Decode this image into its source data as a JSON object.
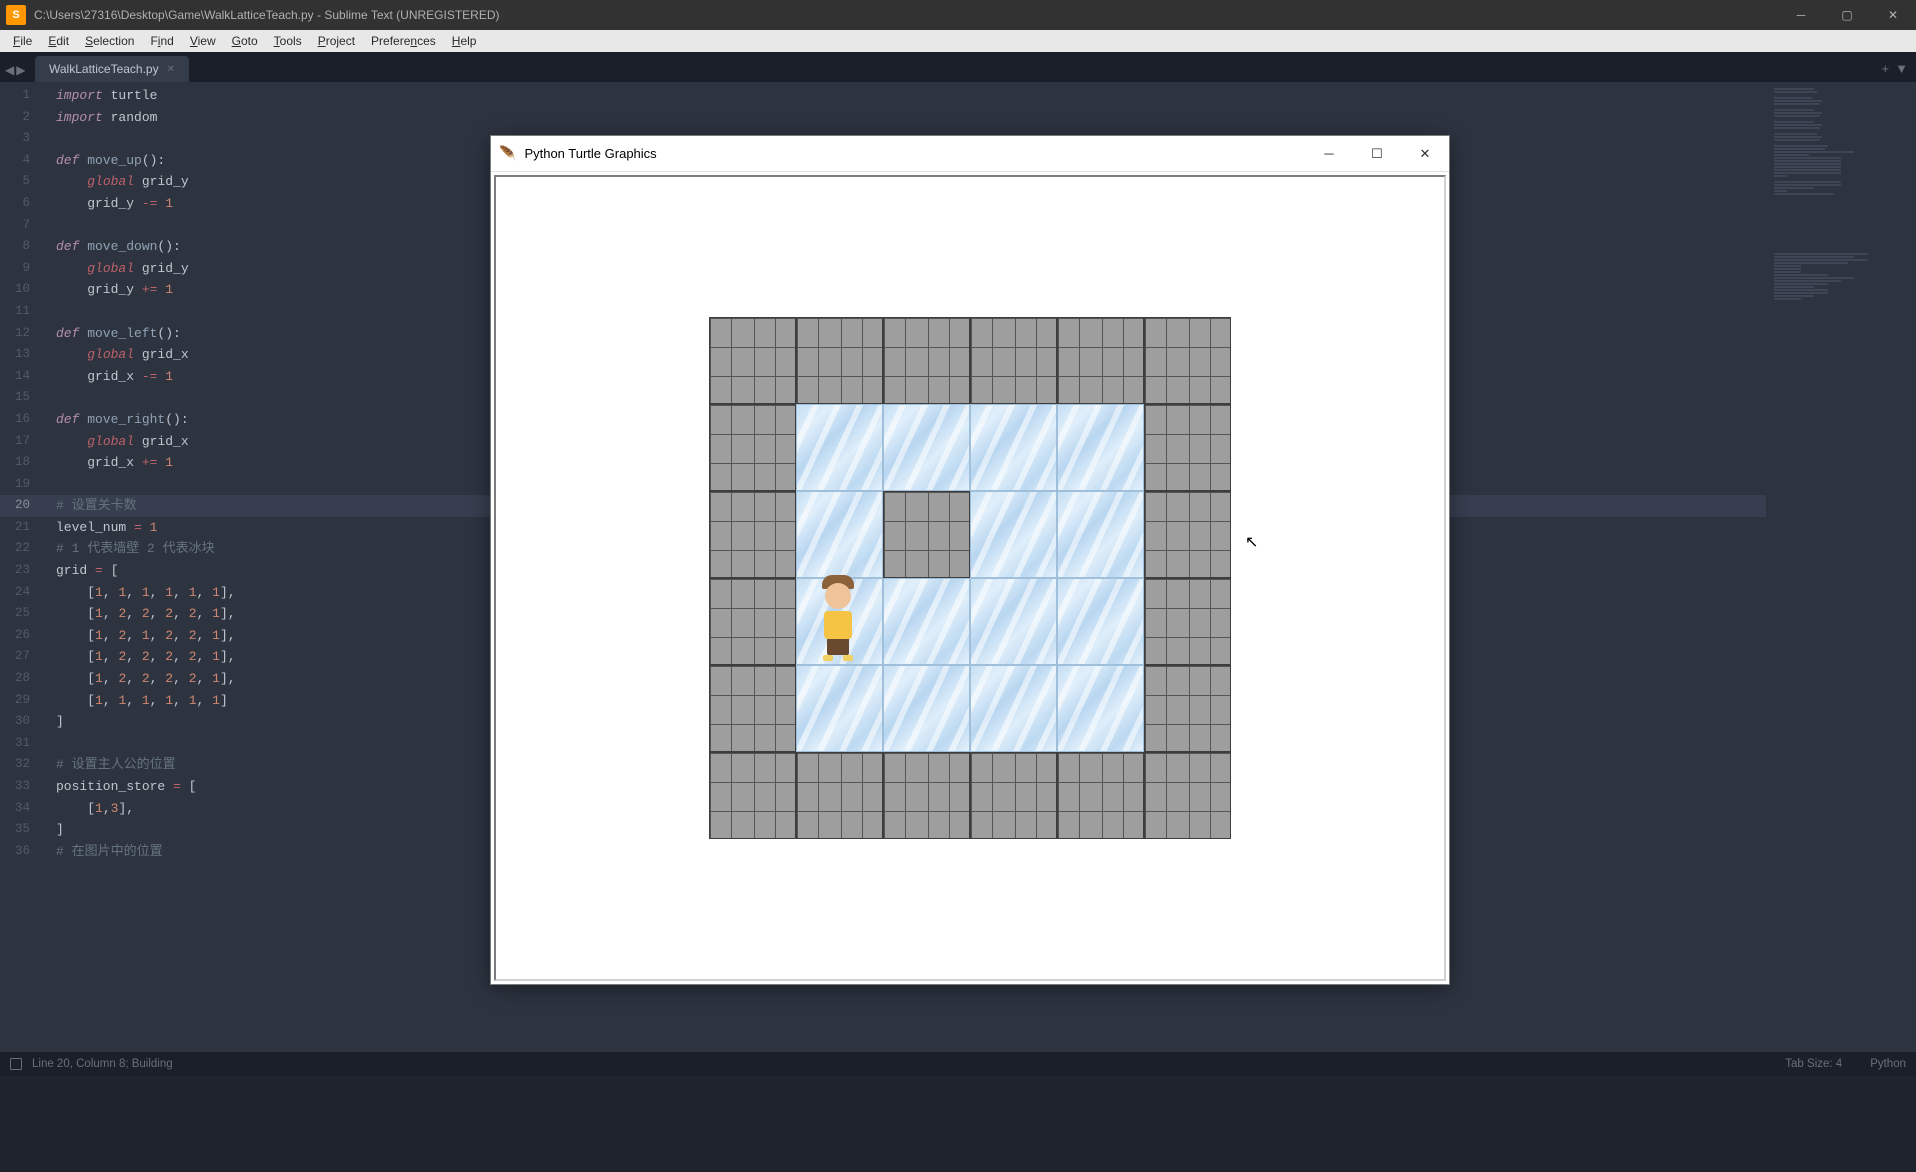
{
  "titlebar": {
    "path": "C:\\Users\\27316\\Desktop\\Game\\WalkLatticeTeach.py - Sublime Text (UNREGISTERED)"
  },
  "menu": {
    "file": "File",
    "edit": "Edit",
    "selection": "Selection",
    "find": "Find",
    "view": "View",
    "goto": "Goto",
    "tools": "Tools",
    "project": "Project",
    "preferences": "Preferences",
    "help": "Help"
  },
  "tab": {
    "filename": "WalkLatticeTeach.py"
  },
  "statusbar": {
    "left": "Line 20, Column 8; Building",
    "tabsize": "Tab Size: 4",
    "lang": "Python"
  },
  "turtle": {
    "title": "Python Turtle Graphics"
  },
  "code": {
    "l1a": "import",
    "l1b": " turtle",
    "l2a": "import",
    "l2b": " random",
    "l4a": "def",
    "l4b": " move_up",
    "l4c": "():",
    "l5a": "    ",
    "l5b": "global",
    "l5c": " grid_y",
    "l6a": "    grid_y ",
    "l6b": "-=",
    "l6c": " ",
    "l6d": "1",
    "l8a": "def",
    "l8b": " move_down",
    "l8c": "():",
    "l9a": "    ",
    "l9b": "global",
    "l9c": " grid_y",
    "l10a": "    grid_y ",
    "l10b": "+=",
    "l10c": " ",
    "l10d": "1",
    "l12a": "def",
    "l12b": " move_left",
    "l12c": "():",
    "l13a": "    ",
    "l13b": "global",
    "l13c": " grid_x",
    "l14a": "    grid_x ",
    "l14b": "-=",
    "l14c": " ",
    "l14d": "1",
    "l16a": "def",
    "l16b": " move_right",
    "l16c": "():",
    "l17a": "    ",
    "l17b": "global",
    "l17c": " grid_x",
    "l18a": "    grid_x ",
    "l18b": "+=",
    "l18c": " ",
    "l18d": "1",
    "l20a": "# 设置关卡数",
    "l21a": "level_num ",
    "l21b": "=",
    "l21c": " ",
    "l21d": "1",
    "l22a": "# 1 代表墙壁 2 代表冰块",
    "l23a": "grid ",
    "l23b": "=",
    "l23c": " [",
    "l24": "    [1, 1, 1, 1, 1, 1],",
    "l25": "    [1, 2, 2, 2, 2, 1],",
    "l26": "    [1, 2, 1, 2, 2, 1],",
    "l27": "    [1, 2, 2, 2, 2, 1],",
    "l28": "    [1, 2, 2, 2, 2, 1],",
    "l29": "    [1, 1, 1, 1, 1, 1]",
    "l30": "]",
    "l32a": "# 设置主人公的位置",
    "l33a": "position_store ",
    "l33b": "=",
    "l33c": " [",
    "l34": "    [1,3],",
    "l35": "]",
    "l36a": "# 在图片中的位置"
  },
  "game": {
    "grid": [
      [
        1,
        1,
        1,
        1,
        1,
        1
      ],
      [
        1,
        2,
        2,
        2,
        2,
        1
      ],
      [
        1,
        2,
        1,
        2,
        2,
        1
      ],
      [
        1,
        2,
        2,
        2,
        2,
        1
      ],
      [
        1,
        2,
        2,
        2,
        2,
        1
      ],
      [
        1,
        1,
        1,
        1,
        1,
        1
      ]
    ],
    "player_position": [
      1,
      3
    ]
  },
  "line_numbers": [
    "1",
    "2",
    "3",
    "4",
    "5",
    "6",
    "7",
    "8",
    "9",
    "10",
    "11",
    "12",
    "13",
    "14",
    "15",
    "16",
    "17",
    "18",
    "19",
    "20",
    "21",
    "22",
    "23",
    "24",
    "25",
    "26",
    "27",
    "28",
    "29",
    "30",
    "31",
    "32",
    "33",
    "34",
    "35",
    "36"
  ],
  "cursor_line": 20
}
